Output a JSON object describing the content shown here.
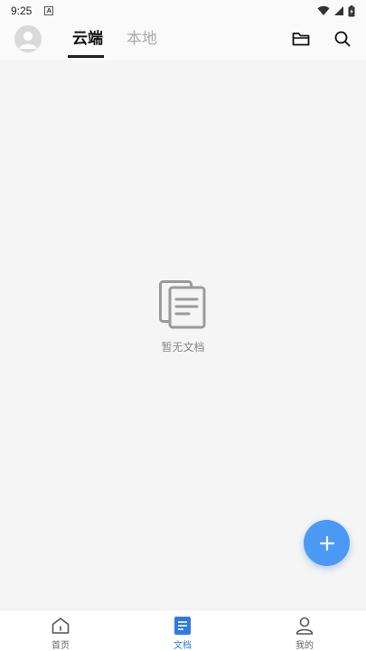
{
  "status_bar": {
    "time": "9:25",
    "notification_badge": "A"
  },
  "header": {
    "tabs": [
      {
        "label": "云端",
        "active": true
      },
      {
        "label": "本地",
        "active": false
      }
    ],
    "icons": [
      "folder-icon",
      "search-icon"
    ]
  },
  "main": {
    "empty_state_text": "暂无文档"
  },
  "fab": {
    "icon": "plus-icon",
    "color": "#4a9af5"
  },
  "bottom_nav": {
    "items": [
      {
        "label": "首页",
        "icon": "home-icon",
        "active": false
      },
      {
        "label": "文档",
        "icon": "document-icon",
        "active": true
      },
      {
        "label": "我的",
        "icon": "person-icon",
        "active": false
      }
    ],
    "active_color": "#2f7ae5"
  }
}
